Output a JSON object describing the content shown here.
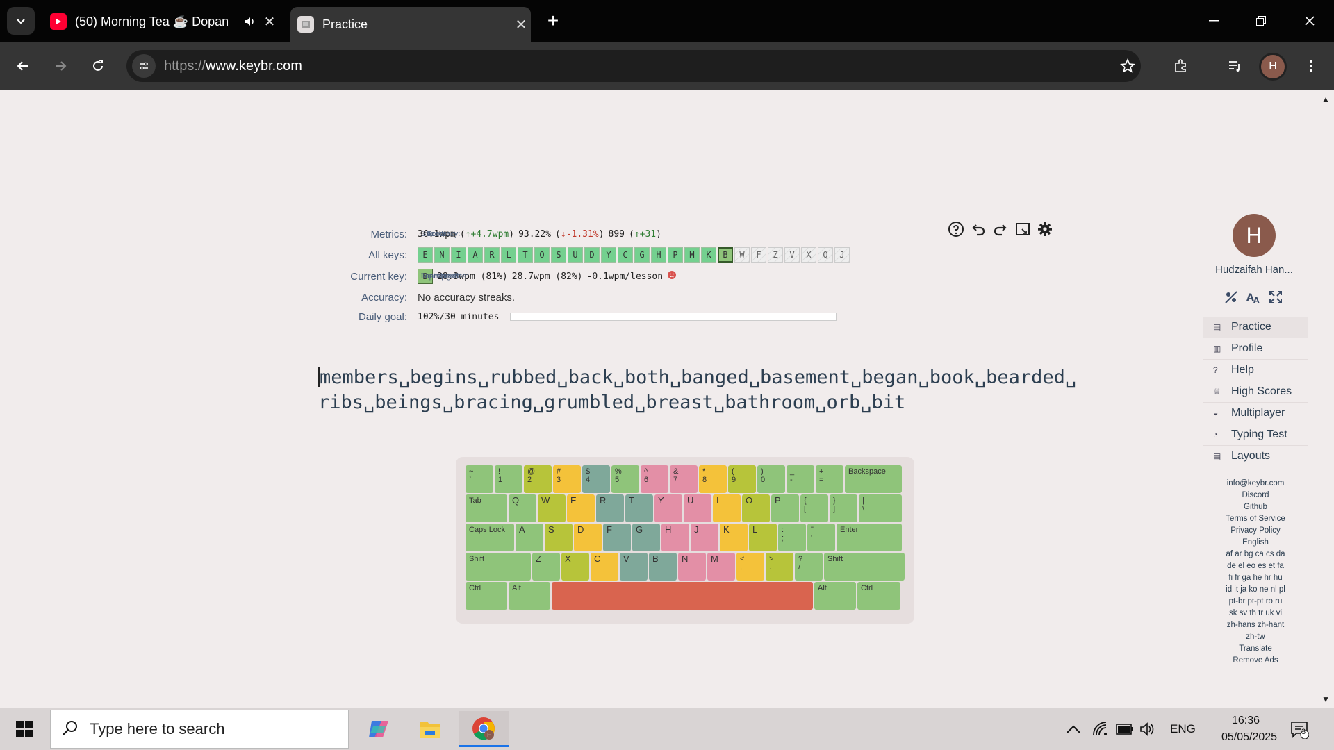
{
  "browser": {
    "tabs": [
      {
        "title": "(50) Morning Tea ☕ Dopan",
        "active": false
      },
      {
        "title": "Practice",
        "active": true
      }
    ],
    "url_scheme": "https://",
    "url_host": "www.keybr.com",
    "profile_initial": "H"
  },
  "metrics": {
    "metrics_label": "Metrics:",
    "speed_label": "Speed:",
    "speed_value": "36.1wpm",
    "speed_delta_open": "(",
    "speed_delta": "↑+4.7wpm",
    "speed_delta_close": ")",
    "accuracy_label": "Accuracy:",
    "accuracy_value": "93.22%",
    "accuracy_delta_open": "(",
    "accuracy_delta": "↓-1.31%",
    "accuracy_delta_close": ")",
    "score_label": "Score:",
    "score_value": "899",
    "score_delta_open": "(",
    "score_delta": "↑+31",
    "score_delta_close": ")",
    "all_keys_label": "All keys:",
    "all_keys": [
      {
        "k": "E",
        "state": "learned"
      },
      {
        "k": "N",
        "state": "learned"
      },
      {
        "k": "I",
        "state": "learned"
      },
      {
        "k": "A",
        "state": "learned"
      },
      {
        "k": "R",
        "state": "learned"
      },
      {
        "k": "L",
        "state": "learned"
      },
      {
        "k": "T",
        "state": "learned"
      },
      {
        "k": "O",
        "state": "learned"
      },
      {
        "k": "S",
        "state": "learned"
      },
      {
        "k": "U",
        "state": "learned"
      },
      {
        "k": "D",
        "state": "learned"
      },
      {
        "k": "Y",
        "state": "learned"
      },
      {
        "k": "C",
        "state": "learned"
      },
      {
        "k": "G",
        "state": "learned"
      },
      {
        "k": "H",
        "state": "learned"
      },
      {
        "k": "P",
        "state": "learned"
      },
      {
        "k": "M",
        "state": "learned"
      },
      {
        "k": "K",
        "state": "learned"
      },
      {
        "k": "B",
        "state": "current"
      },
      {
        "k": "W",
        "state": "locked"
      },
      {
        "k": "F",
        "state": "locked"
      },
      {
        "k": "Z",
        "state": "locked"
      },
      {
        "k": "V",
        "state": "locked"
      },
      {
        "k": "X",
        "state": "locked"
      },
      {
        "k": "Q",
        "state": "locked"
      },
      {
        "k": "J",
        "state": "locked"
      }
    ],
    "current_key_label": "Current key:",
    "current_key": "B",
    "last_speed_label": "Last speed:",
    "last_speed_value": "28.3wpm (81%)",
    "top_speed_label": "Top speed:",
    "top_speed_value": "28.7wpm (82%)",
    "learning_rate_label": "Learning rate:",
    "learning_rate_value": "-0.1wpm/lesson",
    "accuracy2_label": "Accuracy:",
    "accuracy2_value": "No accuracy streaks.",
    "daily_goal_label": "Daily goal:",
    "daily_goal_value": "102%/30 minutes",
    "daily_goal_fraction": 1.0
  },
  "lesson": {
    "line1": "members␣begins␣rubbed␣back␣both␣banged␣basement␣began␣book␣bearded␣",
    "line2": "ribs␣beings␣bracing␣grumbled␣breast␣bathroom␣orb␣bit"
  },
  "keyboard": {
    "row1": [
      "~\n`",
      "!\n1",
      "@\n2",
      "#\n3",
      "$\n4",
      "%\n5",
      "^\n6",
      "&\n7",
      "*\n8",
      "(\n9",
      ")\n0",
      "_\n-",
      "+\n=",
      "Backspace"
    ],
    "row2": [
      "Tab",
      "Q",
      "W",
      "E",
      "R",
      "T",
      "Y",
      "U",
      "I",
      "O",
      "P",
      "{\n[",
      "}\n]",
      "|\n\\"
    ],
    "row3": [
      "Caps Lock",
      "A",
      "S",
      "D",
      "F",
      "G",
      "H",
      "J",
      "K",
      "L",
      ":\n;",
      "\"\n'",
      "Enter"
    ],
    "row4": [
      "Shift",
      "Z",
      "X",
      "C",
      "V",
      "B",
      "N",
      "M",
      "<\n,",
      ">\n.",
      "?\n/",
      "Shift"
    ],
    "row5": [
      "Ctrl",
      "Alt",
      "",
      "Alt",
      "Ctrl"
    ]
  },
  "user": {
    "initial": "H",
    "name": "Hudzaifah Han..."
  },
  "nav": [
    {
      "label": "Practice",
      "icon": "keyboard-icon"
    },
    {
      "label": "Profile",
      "icon": "chart-icon"
    },
    {
      "label": "Help",
      "icon": "help-icon"
    },
    {
      "label": "High Scores",
      "icon": "trophy-icon"
    },
    {
      "label": "Multiplayer",
      "icon": "car-icon"
    },
    {
      "label": "Typing Test",
      "icon": "gauge-icon"
    },
    {
      "label": "Layouts",
      "icon": "keyboard-icon"
    }
  ],
  "footer": {
    "email": "info@keybr.com",
    "discord": "Discord",
    "github": "Github",
    "terms": "Terms of Service",
    "privacy": "Privacy Policy",
    "language": "English",
    "langs1": "af ar bg ca cs da",
    "langs2": "de el eo es et fa",
    "langs3": "fi fr ga he hr hu",
    "langs4": "id it ja ko ne nl pl",
    "langs5": "pt-br pt-pt ro ru",
    "langs6": "sk sv th tr uk vi",
    "langs7": "zh-hans zh-hant",
    "langs8": "zh-tw",
    "translate": "Translate",
    "remove_ads": "Remove Ads"
  },
  "taskbar": {
    "search_placeholder": "Type here to search",
    "lang": "ENG",
    "time": "16:36",
    "date": "05/05/2025",
    "notif_count": "3"
  },
  "colors": {
    "learned": "#74d08f",
    "current": "#8fc47a",
    "accent_red": "#c0392b",
    "space_bar": "#d9644f"
  }
}
